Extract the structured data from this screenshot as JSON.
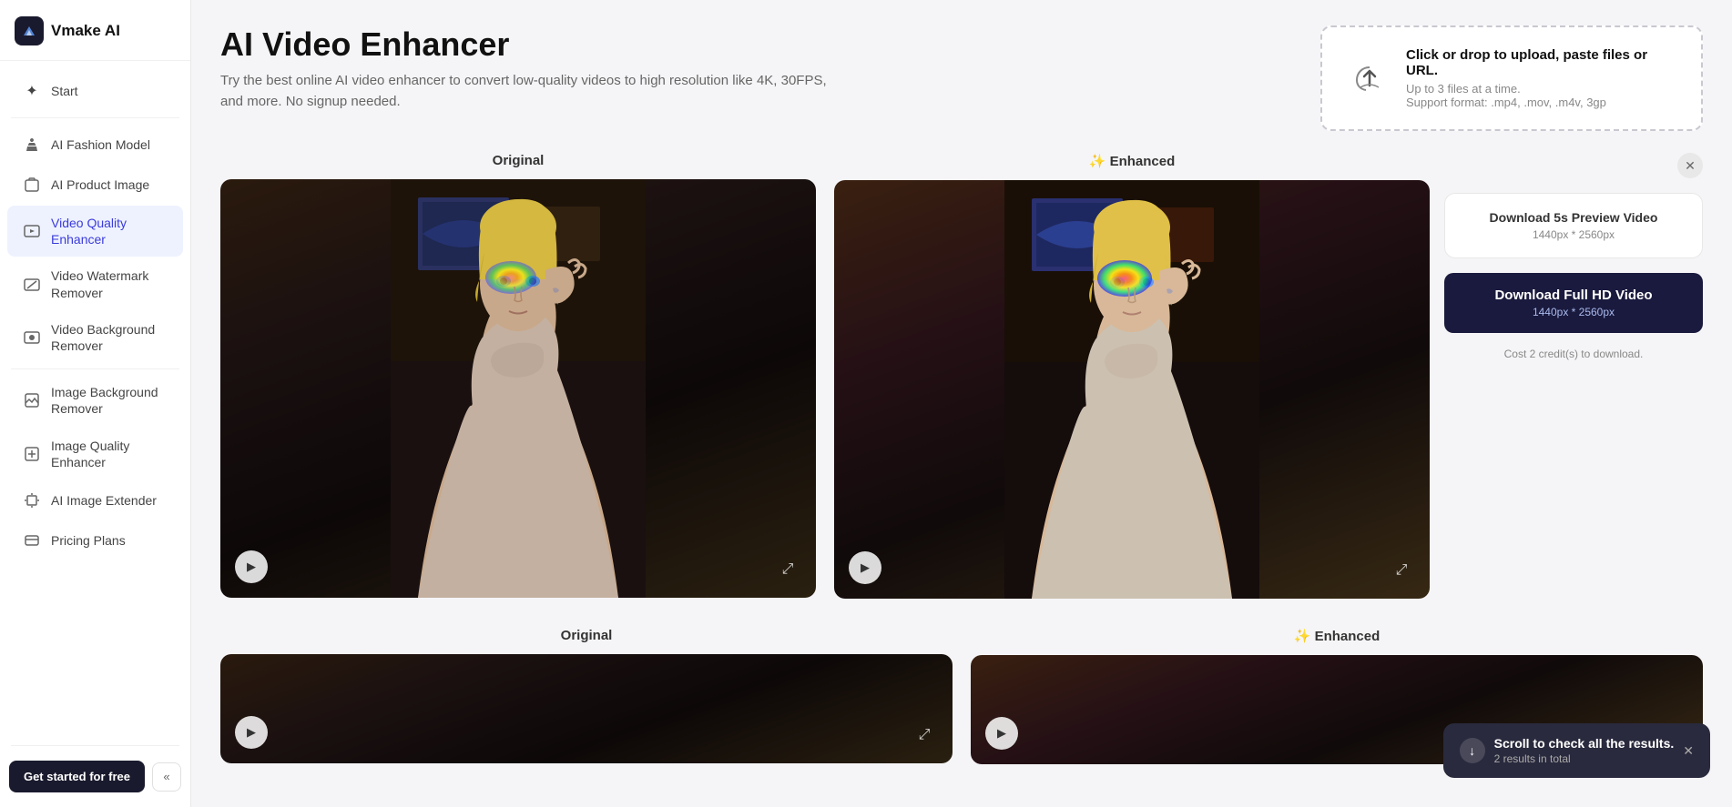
{
  "app": {
    "name": "Vmake AI"
  },
  "sidebar": {
    "start_label": "Start",
    "items": [
      {
        "id": "fashion-model",
        "label": "AI Fashion Model",
        "icon": "👗",
        "active": false
      },
      {
        "id": "product-image",
        "label": "AI Product Image",
        "icon": "🛍️",
        "active": false
      },
      {
        "id": "video-quality-enhancer",
        "label": "Video Quality Enhancer",
        "icon": "✨",
        "active": true
      },
      {
        "id": "video-watermark-remover",
        "label": "Video Watermark Remover",
        "icon": "🎬",
        "active": false
      },
      {
        "id": "video-background-remover",
        "label": "Video Background Remover",
        "icon": "🎥",
        "active": false
      },
      {
        "id": "image-background-remover",
        "label": "Image Background Remover",
        "icon": "🖼️",
        "active": false
      },
      {
        "id": "image-quality-enhancer",
        "label": "Image Quality Enhancer",
        "icon": "🌟",
        "active": false
      },
      {
        "id": "ai-image-extender",
        "label": "AI Image Extender",
        "icon": "↔️",
        "active": false
      },
      {
        "id": "pricing-plans",
        "label": "Pricing Plans",
        "icon": "💳",
        "active": false
      }
    ],
    "cta_label": "Get started for free",
    "collapse_icon": "«"
  },
  "page": {
    "title": "AI Video Enhancer",
    "subtitle": "Try the best online AI video enhancer to convert low-quality videos to high resolution like 4K, 30FPS, and more. No signup needed."
  },
  "upload": {
    "main_text": "Click or drop to upload, paste files or URL.",
    "sub_text": "Up to 3 files at a time.",
    "format_text": "Support format: .mp4, .mov, .m4v, 3gp"
  },
  "comparison": {
    "original_label": "Original",
    "enhanced_label": "✨ Enhanced"
  },
  "right_panel": {
    "download_preview_title": "Download 5s Preview Video",
    "download_preview_dim": "1440px * 2560px",
    "download_full_title": "Download Full HD Video",
    "download_full_dim": "1440px * 2560px",
    "cost_text": "Cost 2 credit(s) to download."
  },
  "toast": {
    "main_text": "Scroll to check all the results.",
    "sub_text": "2 results in total",
    "arrow_icon": "↓"
  }
}
